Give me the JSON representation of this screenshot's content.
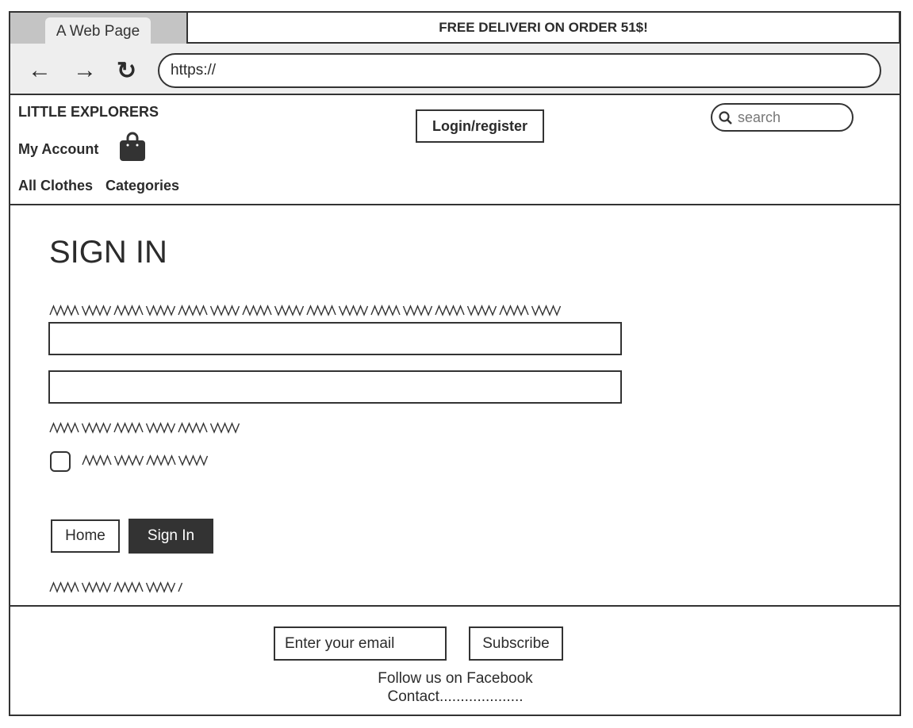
{
  "browser": {
    "tab_title": "A Web Page",
    "url": "https://",
    "back_icon": "←",
    "forward_icon": "→",
    "reload_icon": "↻"
  },
  "promo_banner": "FREE DELIVERI ON ORDER 51$!",
  "header": {
    "brand": "LITTLE EXPLORERS",
    "my_account": "My Account",
    "login_register": "Login/register",
    "search_placeholder": "search",
    "nav": [
      "All Clothes",
      "Categories"
    ]
  },
  "main": {
    "title": "SIGN IN",
    "home_button": "Home",
    "sign_in_button": "Sign In"
  },
  "footer": {
    "email_placeholder": "Enter your email",
    "subscribe": "Subscribe",
    "follow": "Follow us on Facebook",
    "contact": "Contact...................."
  }
}
